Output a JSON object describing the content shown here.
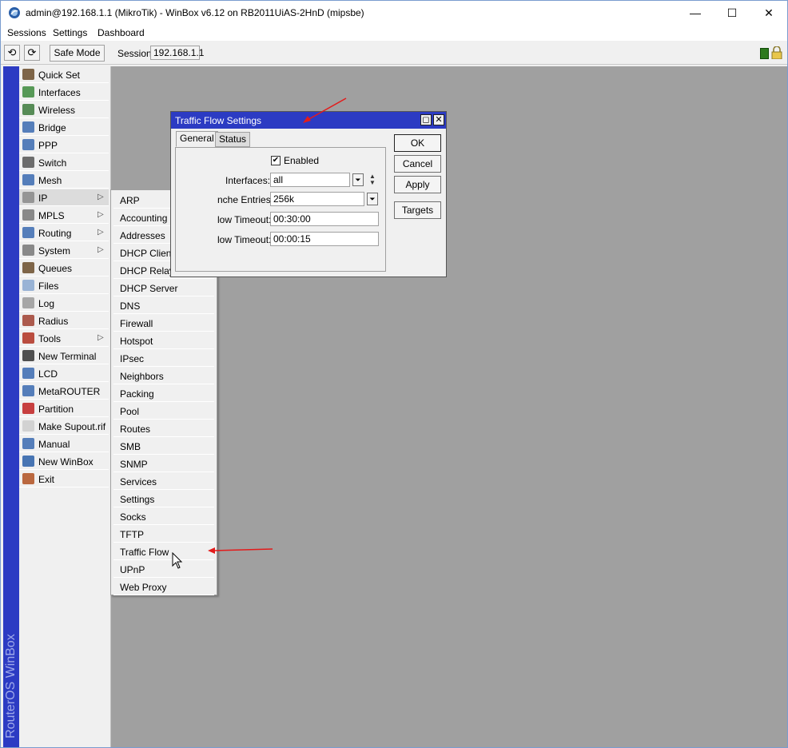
{
  "window": {
    "title": "admin@192.168.1.1 (MikroTik) - WinBox v6.12 on RB2011UiAS-2HnD (mipsbe)",
    "minimize_glyph": "—",
    "maximize_glyph": "☐",
    "close_glyph": "✕"
  },
  "menubar": {
    "sessions": "Sessions",
    "settings": "Settings",
    "dashboard": "Dashboard"
  },
  "toolbar": {
    "undo_glyph": "⟲",
    "redo_glyph": "⟳",
    "safe_mode": "Safe Mode",
    "session_label": "Session:",
    "session_value": "192.168.1.1"
  },
  "brand_vertical": "RouterOS WinBox",
  "sidebar": {
    "items": [
      {
        "label": "Quick Set",
        "icon": "wand-icon"
      },
      {
        "label": "Interfaces",
        "icon": "interfaces-icon"
      },
      {
        "label": "Wireless",
        "icon": "wireless-icon"
      },
      {
        "label": "Bridge",
        "icon": "bridge-icon"
      },
      {
        "label": "PPP",
        "icon": "ppp-icon"
      },
      {
        "label": "Switch",
        "icon": "switch-icon"
      },
      {
        "label": "Mesh",
        "icon": "mesh-icon"
      },
      {
        "label": "IP",
        "icon": "ip-icon",
        "submenu": true
      },
      {
        "label": "MPLS",
        "icon": "mpls-icon",
        "submenu": true
      },
      {
        "label": "Routing",
        "icon": "routing-icon",
        "submenu": true
      },
      {
        "label": "System",
        "icon": "gear-icon",
        "submenu": true
      },
      {
        "label": "Queues",
        "icon": "queues-icon"
      },
      {
        "label": "Files",
        "icon": "folder-icon"
      },
      {
        "label": "Log",
        "icon": "log-icon"
      },
      {
        "label": "Radius",
        "icon": "radius-icon"
      },
      {
        "label": "Tools",
        "icon": "tools-icon",
        "submenu": true
      },
      {
        "label": "New Terminal",
        "icon": "terminal-icon"
      },
      {
        "label": "LCD",
        "icon": "lcd-icon"
      },
      {
        "label": "MetaROUTER",
        "icon": "metarouter-icon"
      },
      {
        "label": "Partition",
        "icon": "pie-icon"
      },
      {
        "label": "Make Supout.rif",
        "icon": "document-icon"
      },
      {
        "label": "Manual",
        "icon": "help-icon"
      },
      {
        "label": "New WinBox",
        "icon": "globe-icon"
      },
      {
        "label": "Exit",
        "icon": "exit-icon"
      }
    ],
    "submenu_arrow": "▷"
  },
  "ip_submenu": {
    "items": [
      "ARP",
      "Accounting",
      "Addresses",
      "DHCP Client",
      "DHCP Relay",
      "DHCP Server",
      "DNS",
      "Firewall",
      "Hotspot",
      "IPsec",
      "Neighbors",
      "Packing",
      "Pool",
      "Routes",
      "SMB",
      "SNMP",
      "Services",
      "Settings",
      "Socks",
      "TFTP",
      "Traffic Flow",
      "UPnP",
      "Web Proxy"
    ]
  },
  "dialog": {
    "title": "Traffic Flow Settings",
    "restore_glyph": "◻",
    "close_glyph": "✕",
    "tabs": {
      "general": "General",
      "status": "Status"
    },
    "enabled_label": "Enabled",
    "enabled_check": "✔",
    "interfaces_label": "Interfaces:",
    "interfaces_value": "all",
    "cache_label": "nche Entries:",
    "cache_value": "256k",
    "active_timeout_label": "low Timeout:",
    "active_timeout_value": "00:30:00",
    "inactive_timeout_label": "low Timeout:",
    "inactive_timeout_value": "00:00:15",
    "dropdown_glyph": "⏷",
    "updown_glyph_up": "▲",
    "updown_glyph_down": "▼",
    "buttons": {
      "ok": "OK",
      "cancel": "Cancel",
      "apply": "Apply",
      "targets": "Targets"
    }
  },
  "colors": {
    "accent": "#2c3bc3",
    "workspace": "#a0a0a0",
    "annotation": "#e31b1b"
  }
}
